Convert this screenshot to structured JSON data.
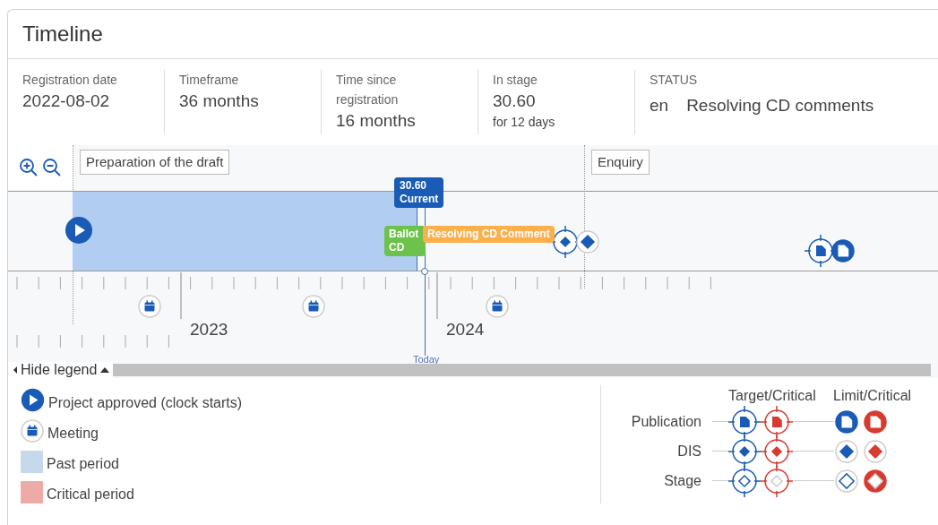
{
  "window": {
    "title": "Timeline"
  },
  "info": [
    {
      "label": "Registration date",
      "value": "2022-08-02"
    },
    {
      "label": "Timeframe",
      "value": "36 months"
    },
    {
      "label": "Time since registration",
      "value": "16 months"
    },
    {
      "label": "In stage",
      "value": "30.60",
      "note": "for 12 days"
    },
    {
      "label": "STATUS",
      "language": "en",
      "value": "Resolving CD comments"
    }
  ],
  "timeline": {
    "phases": [
      {
        "label": "Preparation of the draft"
      },
      {
        "label": "Enquiry"
      }
    ],
    "current": {
      "code": "30.60",
      "label": "Current"
    },
    "stage_tags": [
      {
        "label": "Ballot CD",
        "color": "#6cc24a"
      },
      {
        "label": "Resolving CD Comment",
        "color": "#fbb04c"
      }
    ],
    "years": [
      "2023",
      "2024"
    ],
    "today": "Today"
  },
  "legend_toggle": "Hide legend",
  "legend": {
    "items": [
      {
        "kind": "start",
        "label": "Project approved (clock starts)"
      },
      {
        "kind": "meeting",
        "label": "Meeting"
      },
      {
        "kind": "swatch",
        "label": "Past period",
        "color": "#c6d9ec"
      },
      {
        "kind": "swatch",
        "label": "Critical period",
        "color": "#eeaaa7"
      }
    ],
    "columns": [
      "Target/Critical",
      "Limit/Critical"
    ],
    "rows": [
      {
        "kind": "publication",
        "label": "Publication"
      },
      {
        "kind": "dis",
        "label": "DIS"
      },
      {
        "kind": "stage",
        "label": "Stage"
      }
    ]
  }
}
